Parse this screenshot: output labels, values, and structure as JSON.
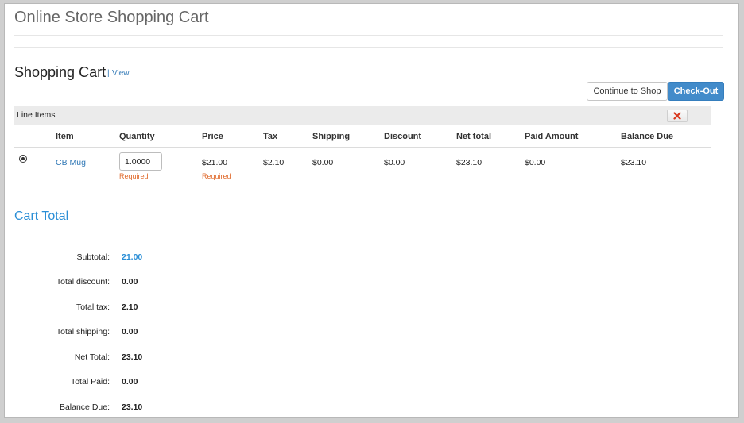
{
  "page_title": "Online Store Shopping Cart",
  "cart": {
    "heading": "Shopping Cart",
    "view_sep": "|",
    "view_link": "View",
    "continue_label": "Continue to Shop",
    "checkout_label": "Check-Out"
  },
  "line_items": {
    "label": "Line Items",
    "columns": [
      "Item",
      "Quantity",
      "Price",
      "Tax",
      "Shipping",
      "Discount",
      "Net total",
      "Paid Amount",
      "Balance Due"
    ],
    "rows": [
      {
        "item": "CB Mug",
        "quantity": "1.0000",
        "quantity_note": "Required",
        "price": "$21.00",
        "price_note": "Required",
        "tax": "$2.10",
        "shipping": "$0.00",
        "discount": "$0.00",
        "net_total": "$23.10",
        "paid_amount": "$0.00",
        "balance_due": "$23.10"
      }
    ]
  },
  "cart_total": {
    "heading": "Cart Total",
    "rows": [
      {
        "label": "Subtotal:",
        "value": "21.00"
      },
      {
        "label": "Total discount:",
        "value": "0.00"
      },
      {
        "label": "Total tax:",
        "value": "2.10"
      },
      {
        "label": "Total shipping:",
        "value": "0.00"
      },
      {
        "label": "Net Total:",
        "value": "23.10"
      },
      {
        "label": "Total Paid:",
        "value": "0.00"
      },
      {
        "label": "Balance Due:",
        "value": "23.10"
      }
    ]
  },
  "colors": {
    "accent_blue": "#2a8ed6",
    "checkout_bg": "#428bca",
    "required_orange": "#e06a2b",
    "delete_red": "#d9381e"
  },
  "icons": {
    "delete": "x-icon",
    "remove_row": "remove-circle-icon"
  }
}
